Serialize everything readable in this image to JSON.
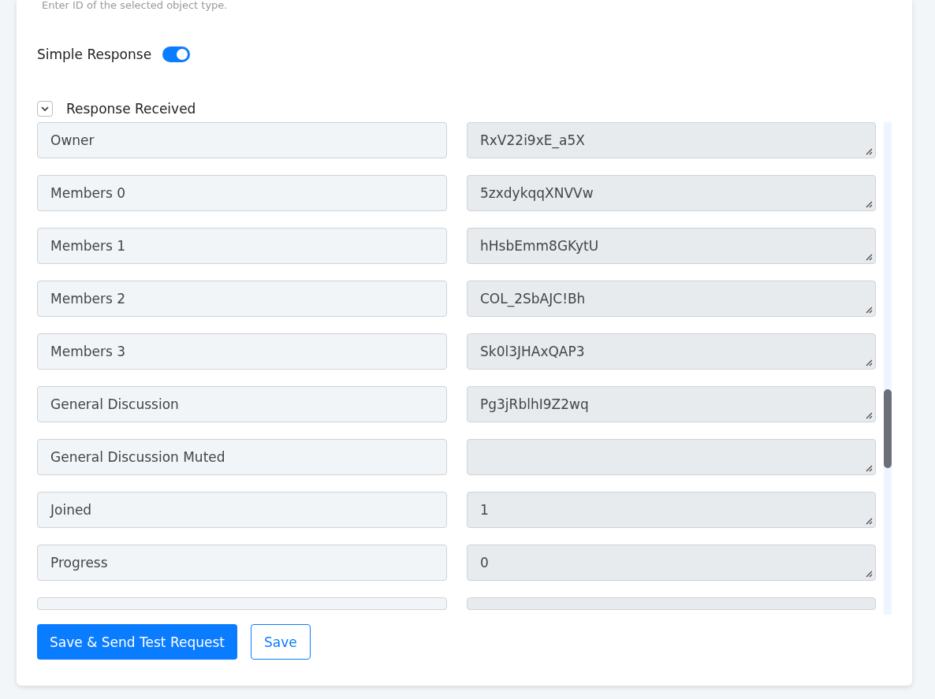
{
  "hint": "Enter ID of the selected object type.",
  "simple_response": {
    "label": "Simple Response",
    "on": true
  },
  "response_section": {
    "label": "Response Received",
    "expanded": true
  },
  "rows": [
    {
      "kind": "field",
      "key": "Owner",
      "value": "RxV22i9xE_a5X"
    },
    {
      "kind": "field",
      "key": "Members 0",
      "value": "5zxdykqqXNVVw"
    },
    {
      "kind": "field",
      "key": "Members 1",
      "value": "hHsbEmm8GKytU"
    },
    {
      "kind": "field",
      "key": "Members 2",
      "value": "COL_2SbAJC!Bh"
    },
    {
      "kind": "field",
      "key": "Members 3",
      "value": "Sk0l3JHAxQAP3"
    },
    {
      "kind": "field",
      "key": "General Discussion",
      "value": "Pg3jRblhI9Z2wq"
    },
    {
      "kind": "field",
      "key": "General Discussion Muted",
      "value": ""
    },
    {
      "kind": "field",
      "key": "Joined",
      "value": "1"
    },
    {
      "kind": "field",
      "key": "Progress",
      "value": "0"
    },
    {
      "kind": "clipped"
    }
  ],
  "buttons": [
    {
      "kind": "primary",
      "label": "Save & Send Test Request"
    },
    {
      "kind": "outline",
      "label": "Save"
    }
  ]
}
